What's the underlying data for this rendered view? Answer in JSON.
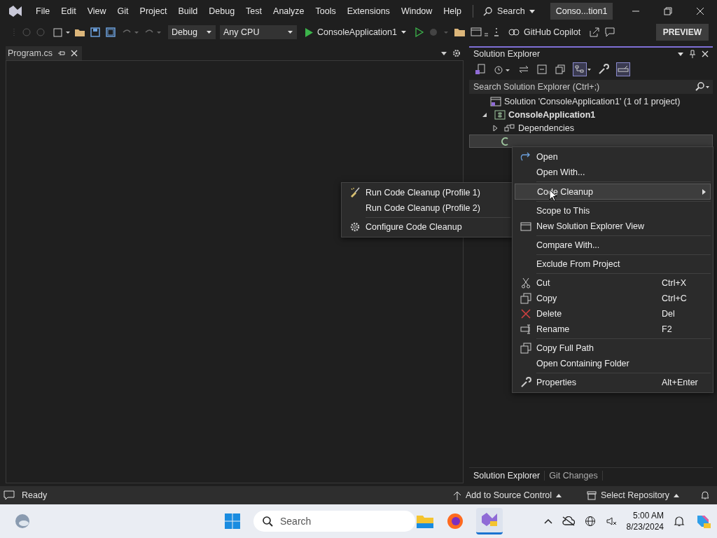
{
  "menu_bar": {
    "items": [
      "File",
      "Edit",
      "View",
      "Git",
      "Project",
      "Build",
      "Debug",
      "Test",
      "Analyze",
      "Tools",
      "Extensions",
      "Window",
      "Help"
    ]
  },
  "title_search": {
    "label": "Search"
  },
  "solution_badge": "Conso...tion1",
  "toolbar": {
    "configuration": "Debug",
    "platform": "Any CPU",
    "start_target": "ConsoleApplication1",
    "copilot": "GitHub Copilot",
    "preview": "PREVIEW"
  },
  "document_tabs": [
    {
      "label": "Program.cs",
      "selected": true
    }
  ],
  "solution_explorer": {
    "title": "Solution Explorer",
    "search_placeholder": "Search Solution Explorer (Ctrl+;)",
    "tree": [
      {
        "label": "Solution 'ConsoleApplication1' (1 of 1 project)",
        "selected": false,
        "children": [
          {
            "label": "ConsoleApplication1",
            "selected": false,
            "expanded": true,
            "children": [
              {
                "label": "Dependencies",
                "kind": "dependencies",
                "selected": false,
                "expanded": false
              },
              {
                "kind": "file",
                "selected": true
              }
            ]
          }
        ]
      }
    ],
    "bottom_tabs": [
      {
        "label": "Solution Explorer",
        "selected": true
      },
      {
        "label": "Git Changes",
        "selected": false
      }
    ]
  },
  "context_menu": {
    "groups": [
      [
        {
          "label": "Open",
          "selected": false
        },
        {
          "label": "Open With...",
          "selected": false
        }
      ],
      [
        {
          "label": "Code Cleanup",
          "selected": true,
          "submenu": true
        }
      ],
      [
        {
          "label": "Scope to This",
          "selected": false
        },
        {
          "label": "New Solution Explorer View",
          "selected": false
        }
      ],
      [
        {
          "label": "Compare With...",
          "selected": false
        }
      ],
      [
        {
          "label": "Exclude From Project",
          "selected": false
        }
      ],
      [
        {
          "label": "Cut",
          "shortcut": "Ctrl+X",
          "selected": false
        },
        {
          "label": "Copy",
          "shortcut": "Ctrl+C",
          "selected": false
        },
        {
          "label": "Delete",
          "shortcut": "Del",
          "selected": false
        },
        {
          "label": "Rename",
          "shortcut": "F2",
          "selected": false
        }
      ],
      [
        {
          "label": "Copy Full Path",
          "selected": false
        },
        {
          "label": "Open Containing Folder",
          "selected": false
        }
      ],
      [
        {
          "label": "Properties",
          "shortcut": "Alt+Enter",
          "selected": false
        }
      ]
    ]
  },
  "submenu": {
    "groups": [
      [
        {
          "label": "Run Code Cleanup (Profile 1)",
          "selected": false
        },
        {
          "label": "Run Code Cleanup (Profile 2)",
          "selected": false
        }
      ],
      [
        {
          "label": "Configure Code Cleanup",
          "selected": false
        }
      ]
    ]
  },
  "status_bar": {
    "text": "Ready",
    "source_control": "Add to Source Control",
    "repository": "Select Repository"
  },
  "taskbar": {
    "search_placeholder": "Search",
    "time": "5:00 AM",
    "date": "8/23/2024"
  }
}
